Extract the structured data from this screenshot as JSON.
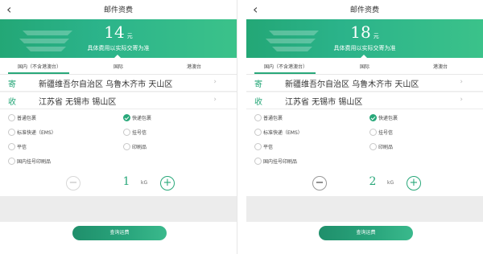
{
  "colors": {
    "accent": "#29a87a",
    "hero_start": "#23a776",
    "hero_end": "#3bc28a"
  },
  "panels": [
    {
      "title": "邮件资费",
      "price": "14",
      "price_unit": "元",
      "price_note": "具体费用以实际交寄为准",
      "tabs": [
        "国内（不含港澳台）",
        "国际",
        "港澳台"
      ],
      "active_tab": 0,
      "addresses": [
        {
          "tag": "寄",
          "text": "新疆维吾尔自治区 乌鲁木齐市 天山区"
        },
        {
          "tag": "收",
          "text": "江苏省 无锡市 锡山区"
        }
      ],
      "options": [
        {
          "label": "普通包裹",
          "selected": false
        },
        {
          "label": "快递包裹",
          "selected": true
        },
        {
          "label": "标准快递（EMS）",
          "selected": false
        },
        {
          "label": "挂号信",
          "selected": false
        },
        {
          "label": "平信",
          "selected": false
        },
        {
          "label": "印刷品",
          "selected": false
        },
        {
          "label": "国内挂号印刷品",
          "selected": false
        }
      ],
      "quantity": "1",
      "quantity_unit": "kG",
      "minus_label": "−",
      "plus_label": "+",
      "query_label": "查询运费"
    },
    {
      "title": "邮件资费",
      "price": "18",
      "price_unit": "元",
      "price_note": "具体费用以实际交寄为准",
      "tabs": [
        "国内（不含港澳台）",
        "国际",
        "港澳台"
      ],
      "active_tab": 0,
      "addresses": [
        {
          "tag": "寄",
          "text": "新疆维吾尔自治区 乌鲁木齐市 天山区"
        },
        {
          "tag": "收",
          "text": "江苏省 无锡市 锡山区"
        }
      ],
      "options": [
        {
          "label": "普通包裹",
          "selected": false
        },
        {
          "label": "快递包裹",
          "selected": true
        },
        {
          "label": "标准快递（EMS）",
          "selected": false
        },
        {
          "label": "挂号信",
          "selected": false
        },
        {
          "label": "平信",
          "selected": false
        },
        {
          "label": "印刷品",
          "selected": false
        },
        {
          "label": "国内挂号印刷品",
          "selected": false
        }
      ],
      "quantity": "2",
      "quantity_unit": "kG",
      "minus_label": "−",
      "plus_label": "+",
      "query_label": "查询运费"
    }
  ]
}
